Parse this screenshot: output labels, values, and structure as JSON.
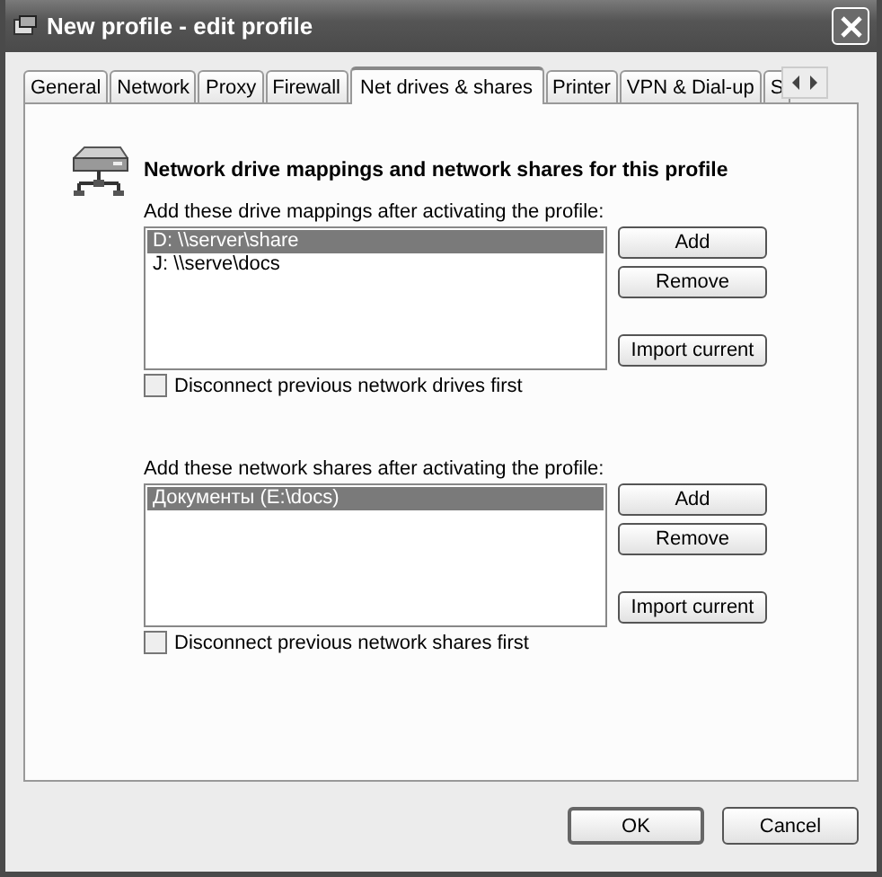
{
  "window": {
    "title": "New profile - edit profile"
  },
  "tabs": [
    {
      "label": "General",
      "selected": false
    },
    {
      "label": "Network",
      "selected": false
    },
    {
      "label": "Proxy",
      "selected": false
    },
    {
      "label": "Firewall",
      "selected": false
    },
    {
      "label": "Net drives & shares",
      "selected": true
    },
    {
      "label": "Printer",
      "selected": false
    },
    {
      "label": "VPN & Dial-up",
      "selected": false
    },
    {
      "label": "S",
      "selected": false
    }
  ],
  "heading": "Network drive mappings and network shares for this profile",
  "sections": [
    {
      "label": "Add these drive mappings after activating the profile:",
      "items": [
        {
          "text": "D:  \\\\server\\share",
          "selected": true
        },
        {
          "text": "J:  \\\\serve\\docs",
          "selected": false
        }
      ],
      "buttons": [
        "Add",
        "Remove",
        "Import current"
      ],
      "checkbox": {
        "label": "Disconnect previous network drives first",
        "checked": false
      }
    },
    {
      "label": "Add these network shares after activating the profile:",
      "items": [
        {
          "text": "Документы (E:\\docs)",
          "selected": true
        }
      ],
      "buttons": [
        "Add",
        "Remove",
        "Import current"
      ],
      "checkbox": {
        "label": "Disconnect previous network shares first",
        "checked": false
      }
    }
  ],
  "buttons": [
    "OK",
    "Cancel"
  ]
}
